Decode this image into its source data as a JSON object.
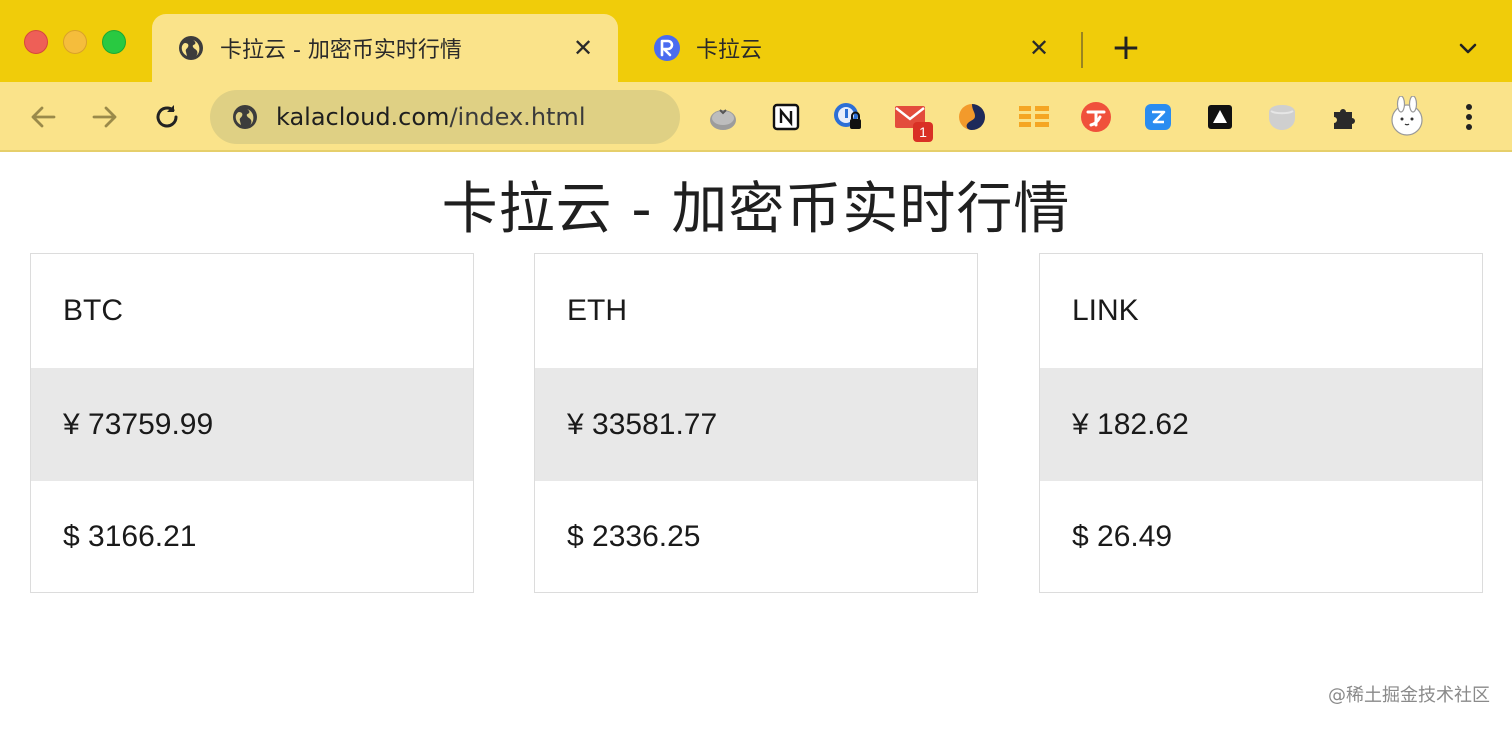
{
  "browser": {
    "tabs": [
      {
        "title": "卡拉云 - 加密币实时行情",
        "favicon": "globe-icon",
        "active": true
      },
      {
        "title": "卡拉云",
        "favicon": "kalacloud-logo-icon",
        "active": false
      }
    ],
    "new_tab_label": "+",
    "address_bar": {
      "domain": "kalacloud.com",
      "path": "/index.html"
    },
    "extensions": [
      {
        "name": "tomato-timer-icon"
      },
      {
        "name": "notion-icon"
      },
      {
        "name": "password-lock-icon"
      },
      {
        "name": "mail-icon",
        "badge": "1"
      },
      {
        "name": "swirl-icon"
      },
      {
        "name": "list-grid-icon"
      },
      {
        "name": "translate-icon"
      },
      {
        "name": "blue-square-icon"
      },
      {
        "name": "dark-square-icon"
      },
      {
        "name": "cloud-icon"
      },
      {
        "name": "puzzle-icon"
      },
      {
        "name": "rabbit-avatar-icon"
      },
      {
        "name": "more-menu-icon"
      }
    ],
    "colors": {
      "tabstrip": "#f0cc0a",
      "active_tab": "#fae38a",
      "omnibox": "#dfd084"
    }
  },
  "page": {
    "title": "卡拉云 - 加密币实时行情",
    "cards": [
      {
        "symbol": "BTC",
        "cny": "¥ 73759.99",
        "usd": "$ 3166.21"
      },
      {
        "symbol": "ETH",
        "cny": "¥ 33581.77",
        "usd": "$ 2336.25"
      },
      {
        "symbol": "LINK",
        "cny": "¥ 182.62",
        "usd": "$ 26.49"
      }
    ]
  },
  "watermark": "@稀土掘金技术社区"
}
